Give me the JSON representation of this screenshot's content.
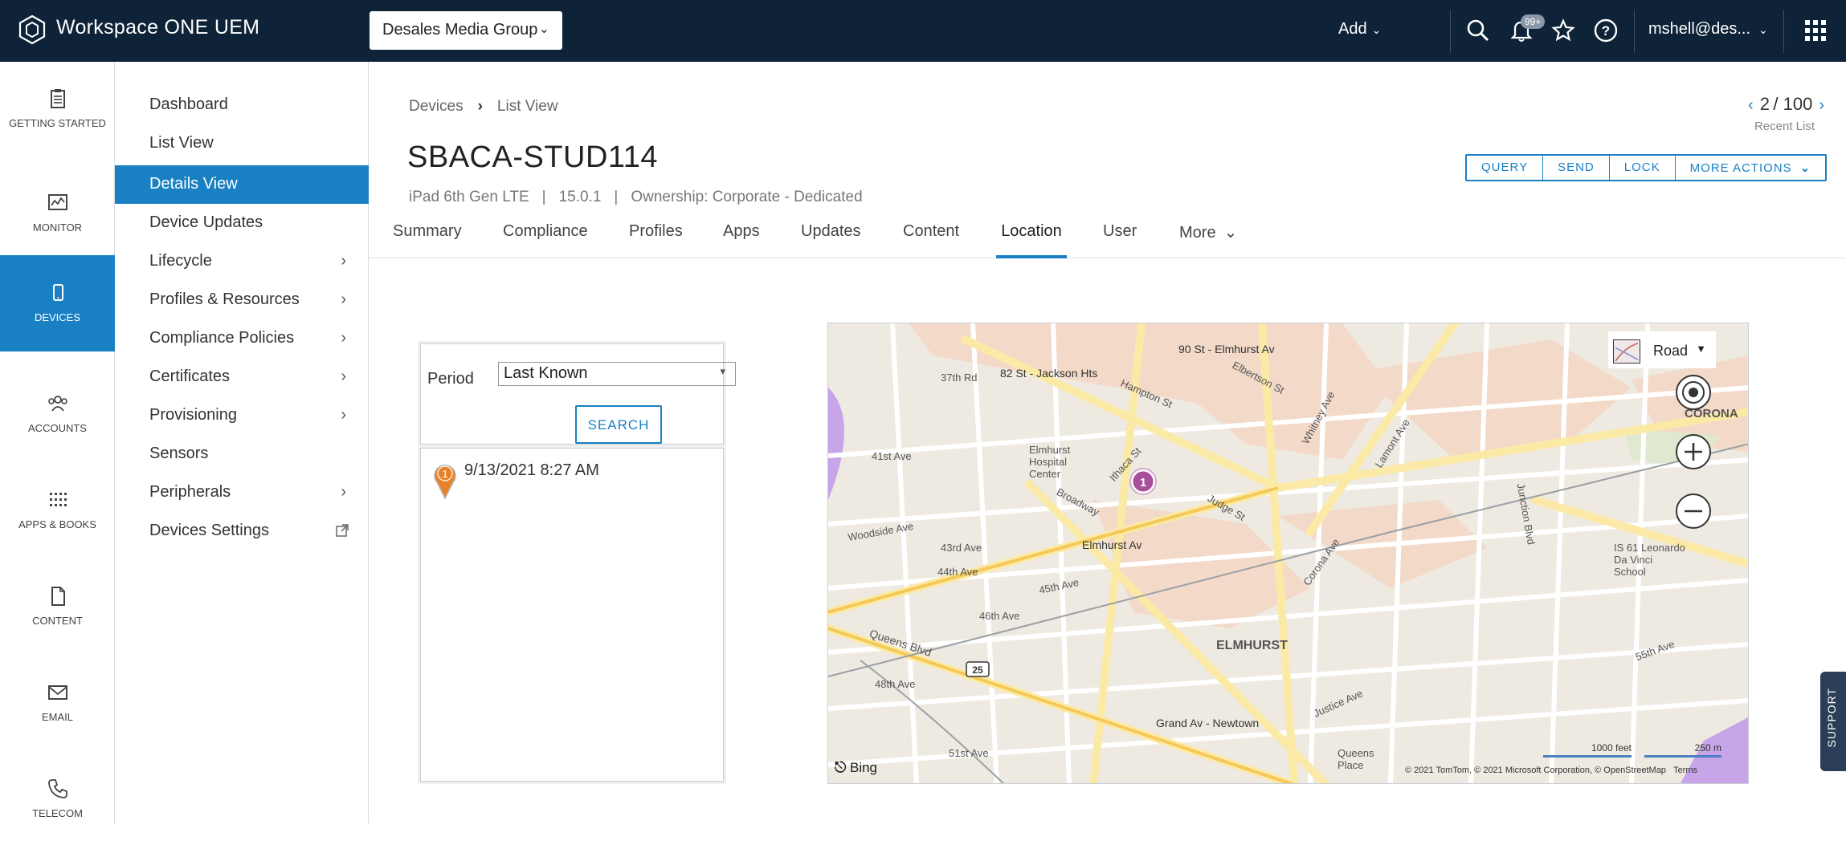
{
  "topbar": {
    "app_title": "Workspace ONE UEM",
    "org": "Desales Media Group",
    "add_label": "Add",
    "notifications_badge": "99+",
    "user": "mshell@des..."
  },
  "rail": {
    "items": [
      {
        "label": "GETTING STARTED",
        "icon": "clipboard-icon"
      },
      {
        "label": "MONITOR",
        "icon": "monitor-icon"
      },
      {
        "label": "DEVICES",
        "icon": "device-icon"
      },
      {
        "label": "ACCOUNTS",
        "icon": "accounts-icon"
      },
      {
        "label": "APPS & BOOKS",
        "icon": "apps-grid-icon"
      },
      {
        "label": "CONTENT",
        "icon": "document-icon"
      },
      {
        "label": "EMAIL",
        "icon": "mail-icon"
      },
      {
        "label": "TELECOM",
        "icon": "phone-icon"
      }
    ]
  },
  "subnav": {
    "items": [
      {
        "label": "Dashboard"
      },
      {
        "label": "List View"
      },
      {
        "label": "Details View"
      },
      {
        "label": "Device Updates"
      },
      {
        "label": "Lifecycle"
      },
      {
        "label": "Profiles & Resources"
      },
      {
        "label": "Compliance Policies"
      },
      {
        "label": "Certificates"
      },
      {
        "label": "Provisioning"
      },
      {
        "label": "Sensors"
      },
      {
        "label": "Peripherals"
      },
      {
        "label": "Devices Settings"
      }
    ]
  },
  "breadcrumb": {
    "root": "Devices",
    "current": "List View"
  },
  "device": {
    "name": "SBACA-STUD114",
    "model": "iPad 6th Gen LTE",
    "os": "15.0.1",
    "ownership": "Ownership: Corporate - Dedicated"
  },
  "pager": {
    "current": "2",
    "total": "/ 100",
    "label": "Recent List"
  },
  "actions": {
    "query": "QUERY",
    "send": "SEND",
    "lock": "LOCK",
    "more": "MORE ACTIONS"
  },
  "tabs": [
    "Summary",
    "Compliance",
    "Profiles",
    "Apps",
    "Updates",
    "Content",
    "Location",
    "User",
    "More"
  ],
  "location": {
    "period_label": "Period",
    "period_value": "Last Known",
    "search_label": "SEARCH",
    "results": [
      {
        "index": "1",
        "time": "9/13/2021 8:27 AM"
      }
    ]
  },
  "map": {
    "type_label": "Road",
    "marker": "1",
    "scale_feet": "1000 feet",
    "scale_m": "250 m",
    "bing": "Bing",
    "attribution": "© 2021 TomTom, © 2021 Microsoft Corporation, © OpenStreetMap",
    "terms": "Terms",
    "labels": {
      "l1": "90 St - Elmhurst Av",
      "l2": "82 St - Jackson Hts",
      "l3": "37th Rd",
      "l4": "Elmhurst Hospital Center",
      "l5": "Broadway",
      "l6": "Elmhurst Av",
      "l7": "45th Ave",
      "l8": "Queens Blvd",
      "l9": "ELMHURST",
      "l10": "Grand Av - Newtown",
      "l11": "Corona Ave",
      "l12": "Woodside Ave",
      "l13": "43rd Ave",
      "l14": "44th Ave",
      "l15": "46th Ave",
      "l16": "48th Ave",
      "l17": "51st Ave",
      "l18": "Junction Blvd",
      "l19": "CORONA",
      "l20": "IS 61 Leonardo Da Vinci School",
      "l21": "Queens Place",
      "l22": "55th Ave",
      "l23": "Whitney Ave",
      "l24": "Lamont Ave",
      "l25": "Elbertson St",
      "l26": "Justice Ave",
      "l27": "41st Ave",
      "l28": "Hampton St",
      "l29": "Ithaca St",
      "l30": "Judge St"
    }
  },
  "support_label": "SUPPORT"
}
